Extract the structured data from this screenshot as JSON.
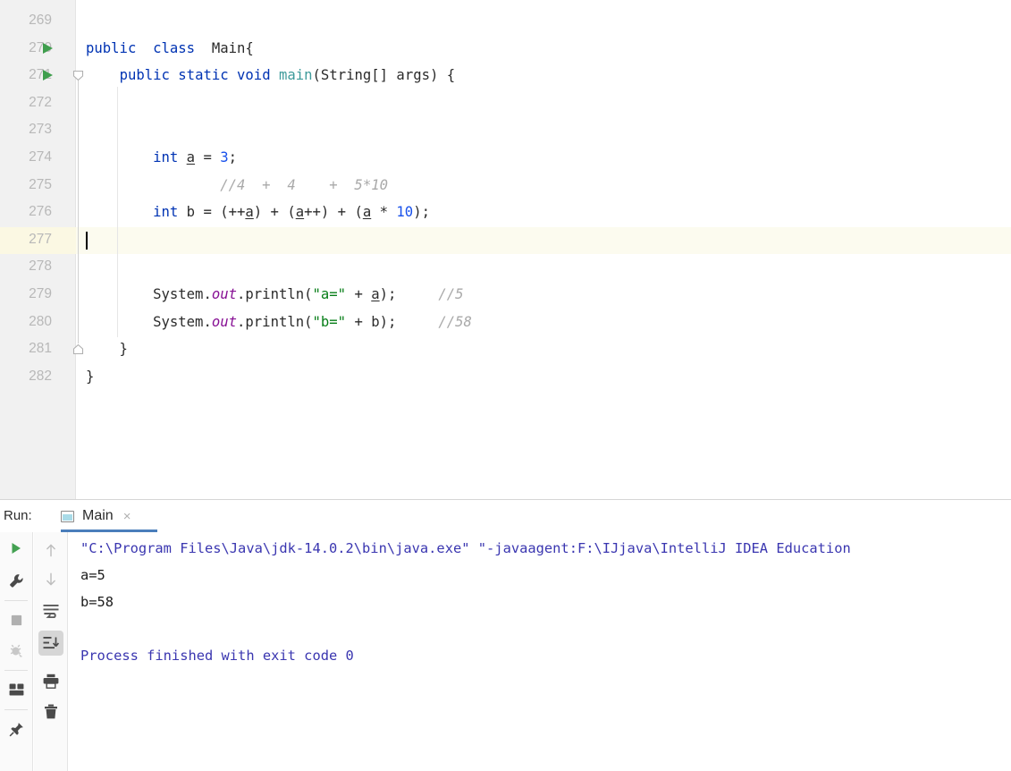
{
  "editor": {
    "gutter_start_line": 268,
    "lines": [
      {
        "no": "269",
        "indent": 0,
        "run_marker": false,
        "tokens": []
      },
      {
        "no": "270",
        "indent": 0,
        "run_marker": true,
        "tokens": [
          {
            "t": "public",
            "c": "kw"
          },
          {
            "t": "  ",
            "c": "plain"
          },
          {
            "t": "class",
            "c": "kw"
          },
          {
            "t": "  ",
            "c": "plain"
          },
          {
            "t": "Main{",
            "c": "cls"
          }
        ]
      },
      {
        "no": "271",
        "indent": 0,
        "run_marker": true,
        "tokens": [
          {
            "t": "    ",
            "c": "plain"
          },
          {
            "t": "public",
            "c": "kw"
          },
          {
            "t": " ",
            "c": "plain"
          },
          {
            "t": "static",
            "c": "kw"
          },
          {
            "t": " ",
            "c": "plain"
          },
          {
            "t": "void",
            "c": "kw"
          },
          {
            "t": " ",
            "c": "plain"
          },
          {
            "t": "main",
            "c": "meth"
          },
          {
            "t": "(String[] args) {",
            "c": "plain"
          }
        ]
      },
      {
        "no": "272",
        "indent": 0,
        "run_marker": false,
        "tokens": []
      },
      {
        "no": "273",
        "indent": 0,
        "run_marker": false,
        "tokens": []
      },
      {
        "no": "274",
        "indent": 0,
        "run_marker": false,
        "tokens": [
          {
            "t": "        ",
            "c": "plain"
          },
          {
            "t": "int",
            "c": "kw"
          },
          {
            "t": " ",
            "c": "plain"
          },
          {
            "t": "a",
            "c": "var"
          },
          {
            "t": " = ",
            "c": "plain"
          },
          {
            "t": "3",
            "c": "num"
          },
          {
            "t": ";",
            "c": "plain"
          }
        ]
      },
      {
        "no": "275",
        "indent": 0,
        "run_marker": false,
        "tokens": [
          {
            "t": "                ",
            "c": "plain"
          },
          {
            "t": "//4  +  4    +  5*10",
            "c": "cmt"
          }
        ]
      },
      {
        "no": "276",
        "indent": 0,
        "run_marker": false,
        "tokens": [
          {
            "t": "        ",
            "c": "plain"
          },
          {
            "t": "int",
            "c": "kw"
          },
          {
            "t": " b = (++",
            "c": "plain"
          },
          {
            "t": "a",
            "c": "var"
          },
          {
            "t": ") + (",
            "c": "plain"
          },
          {
            "t": "a",
            "c": "var"
          },
          {
            "t": "++) + (",
            "c": "plain"
          },
          {
            "t": "a",
            "c": "var"
          },
          {
            "t": " * ",
            "c": "plain"
          },
          {
            "t": "10",
            "c": "num"
          },
          {
            "t": ");",
            "c": "plain"
          }
        ]
      },
      {
        "no": "277",
        "indent": 0,
        "run_marker": false,
        "highlight": true,
        "tokens": []
      },
      {
        "no": "278",
        "indent": 0,
        "run_marker": false,
        "tokens": []
      },
      {
        "no": "279",
        "indent": 0,
        "run_marker": false,
        "tokens": [
          {
            "t": "        ",
            "c": "plain"
          },
          {
            "t": "System",
            "c": "cls"
          },
          {
            "t": ".",
            "c": "plain"
          },
          {
            "t": "out",
            "c": "fld"
          },
          {
            "t": ".println(",
            "c": "plain"
          },
          {
            "t": "\"a=\"",
            "c": "str"
          },
          {
            "t": " + ",
            "c": "plain"
          },
          {
            "t": "a",
            "c": "var"
          },
          {
            "t": ");     ",
            "c": "plain"
          },
          {
            "t": "//5",
            "c": "cmt"
          }
        ]
      },
      {
        "no": "280",
        "indent": 0,
        "run_marker": false,
        "tokens": [
          {
            "t": "        ",
            "c": "plain"
          },
          {
            "t": "System",
            "c": "cls"
          },
          {
            "t": ".",
            "c": "plain"
          },
          {
            "t": "out",
            "c": "fld"
          },
          {
            "t": ".println(",
            "c": "plain"
          },
          {
            "t": "\"b=\"",
            "c": "str"
          },
          {
            "t": " + b);     ",
            "c": "plain"
          },
          {
            "t": "//58",
            "c": "cmt"
          }
        ]
      },
      {
        "no": "281",
        "indent": 0,
        "run_marker": false,
        "tokens": [
          {
            "t": "    }",
            "c": "plain"
          }
        ]
      },
      {
        "no": "282",
        "indent": 0,
        "run_marker": false,
        "tokens": [
          {
            "t": "}",
            "c": "plain"
          }
        ]
      }
    ]
  },
  "run_panel": {
    "label": "Run:",
    "tab": {
      "icon": "console-window-icon",
      "title": "Main",
      "close": "×"
    },
    "toolbar_left": [
      {
        "name": "rerun-button",
        "icon": "play-icon"
      },
      {
        "name": "edit-configurations-button",
        "icon": "wrench-icon"
      },
      {
        "name": "stop-button",
        "icon": "stop-square-icon"
      },
      {
        "name": "resume-program-button",
        "icon": "debug-bug-icon"
      },
      {
        "name": "layout-settings-button",
        "icon": "window-layout-icon"
      },
      {
        "name": "pin-tab-button",
        "icon": "pin-icon"
      }
    ],
    "toolbar_right": [
      {
        "name": "up-the-stack-trace-button",
        "icon": "arrow-up-icon"
      },
      {
        "name": "down-the-stack-trace-button",
        "icon": "arrow-down-icon"
      },
      {
        "name": "soft-wrap-button",
        "icon": "soft-wrap-icon"
      },
      {
        "name": "scroll-to-end-button",
        "icon": "scroll-to-end-icon",
        "active": true
      },
      {
        "name": "print-button",
        "icon": "printer-icon"
      },
      {
        "name": "clear-all-button",
        "icon": "trash-icon"
      }
    ],
    "console_lines": [
      {
        "text": "\"C:\\Program Files\\Java\\jdk-14.0.2\\bin\\java.exe\" \"-javaagent:F:\\IJjava\\IntelliJ IDEA Education",
        "kind": "c-cmd"
      },
      {
        "text": "a=5",
        "kind": "c-out"
      },
      {
        "text": "b=58",
        "kind": "c-out"
      },
      {
        "text": "",
        "kind": "c-out"
      },
      {
        "text": "Process finished with exit code 0",
        "kind": "c-fin"
      }
    ]
  },
  "colors": {
    "keyword": "#0033b3",
    "number": "#1750eb",
    "string": "#067d17",
    "comment": "#a9a9a9",
    "field": "#871094",
    "method": "#3e9b9b",
    "run_marker": "#3f9e4d",
    "console_command": "#3a36b0",
    "current_line": "#fcfbef",
    "gutter": "#f1f1f1",
    "tab_underline": "#4a7ebb"
  }
}
